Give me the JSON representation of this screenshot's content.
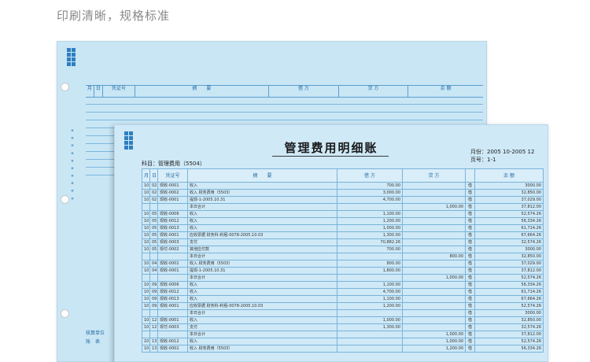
{
  "caption": "印刷清晰，规格标准",
  "back": {
    "headers": [
      "月",
      "日",
      "凭证号",
      "摘　　要",
      "借 方",
      "贷 方",
      "余 额"
    ],
    "footer": [
      "核算单位",
      "账　表"
    ]
  },
  "front": {
    "title": "管理费用明细账",
    "period": "月份：2005 10-2005 12",
    "page": "页号：1-1",
    "account": "科目：管理费用（5504）",
    "headers": [
      "月",
      "日",
      "凭证号",
      "摘　　要",
      "借 方",
      "贷 方",
      "",
      "余 额"
    ],
    "rows": [
      [
        "10",
        "02",
        "现收-0001",
        "收入",
        "700.00",
        "",
        "借",
        "3000.00"
      ],
      [
        "10",
        "02",
        "现收-0002",
        "收入 财务费用（5503）",
        "3,000.00",
        "",
        "借",
        "32,850.00"
      ],
      [
        "10",
        "02",
        "现收-0001",
        "提现-1-2005.10.31",
        "4,700.00",
        "",
        "借",
        "37,029.00"
      ],
      [
        "",
        "",
        "",
        "本日合计",
        "",
        "1,000.00",
        "借",
        "37,812.00"
      ],
      [
        "10",
        "05",
        "现收-0006",
        "收入",
        "1,100.00",
        "",
        "借",
        "52,574.26"
      ],
      [
        "10",
        "05",
        "现收-0012",
        "收入",
        "1,200.00",
        "",
        "借",
        "56,334.26"
      ],
      [
        "10",
        "05",
        "现收-0013",
        "收入",
        "1,000.00",
        "",
        "借",
        "61,714.26"
      ],
      [
        "10",
        "05",
        "现收-0001",
        "应收票据 财务科-利租-0078-2005.10.03",
        "1,300.00",
        "",
        "借",
        "67,664.26"
      ],
      [
        "10",
        "05",
        "现收-0003",
        "支付",
        "70,882.26",
        "",
        "借",
        "32,574.26"
      ],
      [
        "10",
        "05",
        "现付-0002",
        "其他应付款",
        "700.00",
        "",
        "借",
        "3000.00"
      ],
      [
        "",
        "",
        "",
        "本日合计",
        "",
        "800.00",
        "借",
        "32,850.00"
      ],
      [
        "10",
        "04",
        "现收-0002",
        "收入 财务费用（5503）",
        "800.00",
        "",
        "借",
        "37,029.00"
      ],
      [
        "10",
        "04",
        "现收-0001",
        "提现-1-2005.10.31",
        "1,800.00",
        "",
        "借",
        "37,812.00"
      ],
      [
        "",
        "",
        "",
        "本日合计",
        "",
        "1,000.00",
        "借",
        "52,574.26"
      ],
      [
        "10",
        "09",
        "现收-0006",
        "收入",
        "1,100.00",
        "",
        "借",
        "56,334.26"
      ],
      [
        "10",
        "09",
        "现收-0012",
        "收入",
        "4,700.00",
        "",
        "借",
        "61,714.26"
      ],
      [
        "10",
        "09",
        "现收-0013",
        "收入",
        "1,100.00",
        "",
        "借",
        "67,664.26"
      ],
      [
        "10",
        "09",
        "现收-0001",
        "应收票据 财务科-利租-0078-2005.10.03",
        "1,200.00",
        "",
        "借",
        "52,574.26"
      ],
      [
        "",
        "",
        "",
        "本日合计",
        "",
        "",
        "借",
        "3000.00"
      ],
      [
        "10",
        "12",
        "现收-0001",
        "收入",
        "1,000.00",
        "",
        "借",
        "32,850.00"
      ],
      [
        "10",
        "12",
        "现付-0003",
        "支付",
        "1,300.00",
        "",
        "借",
        "32,574.26"
      ],
      [
        "",
        "",
        "",
        "本日合计",
        "",
        "1,000.00",
        "借",
        "37,812.00"
      ],
      [
        "10",
        "13",
        "现收-0012",
        "收入",
        "",
        "1,000.00",
        "借",
        "52,574.26"
      ],
      [
        "10",
        "13",
        "现收-0002",
        "收入 财务费用（5503）",
        "",
        "1,200.00",
        "借",
        "56,334.26"
      ]
    ]
  }
}
